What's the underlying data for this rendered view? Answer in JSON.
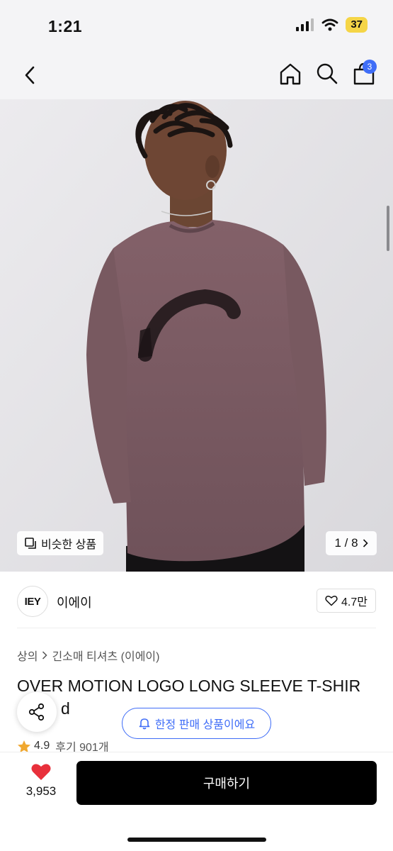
{
  "status": {
    "time": "1:21",
    "battery": "37"
  },
  "nav": {
    "cart_count": "3",
    "icons": [
      "back-icon",
      "home-icon",
      "search-icon",
      "cart-icon"
    ]
  },
  "gallery": {
    "similar_label": "비슷한 상품",
    "page_indicator": "1 / 8"
  },
  "brand": {
    "logo_text": "IEY",
    "name": "이에이",
    "likes": "4.7만"
  },
  "breadcrumb": {
    "category": "상의",
    "subcategory": "긴소매 티셔츠 (이에이)"
  },
  "product": {
    "title_line1": "OVER MOTION LOGO LONG SLEEVE T-SHIR",
    "title_line2_visible": "d",
    "rating": "4.9",
    "reviews": "후기 901개"
  },
  "floating": {
    "limited_label": "한정 판매 상품이에요"
  },
  "bottom": {
    "like_count": "3,953",
    "buy_label": "구매하기"
  },
  "colors": {
    "accent_blue": "#3f6df7",
    "heart_red": "#e8303b",
    "buy_black": "#000000",
    "shirt": "#7d5c64"
  }
}
